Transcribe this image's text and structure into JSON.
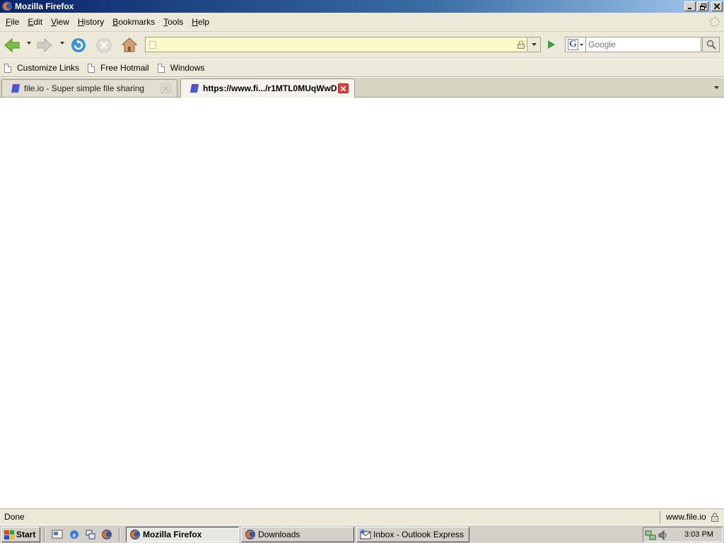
{
  "window": {
    "title": "Mozilla Firefox"
  },
  "menu": {
    "items": [
      {
        "name": "file",
        "accel": "F",
        "rest": "ile"
      },
      {
        "name": "edit",
        "accel": "E",
        "rest": "dit"
      },
      {
        "name": "view",
        "accel": "V",
        "rest": "iew"
      },
      {
        "name": "history",
        "accel": "H",
        "rest": "istory"
      },
      {
        "name": "bookmarks",
        "accel": "B",
        "rest": "ookmarks"
      },
      {
        "name": "tools",
        "accel": "T",
        "rest": "ools"
      },
      {
        "name": "help",
        "accel": "H",
        "rest": "elp"
      }
    ]
  },
  "navigation": {
    "url_value": "",
    "search_engine": "G",
    "search_placeholder": "Google"
  },
  "bookmarks": {
    "items": [
      "Customize Links",
      "Free Hotmail",
      "Windows"
    ]
  },
  "tabs": [
    {
      "label": "file.io - Super simple file sharing",
      "active": false
    },
    {
      "label": "https://www.fi.../r1MTL0MUqWwD",
      "active": true
    }
  ],
  "status": {
    "text": "Done",
    "host": "www.file.io"
  },
  "taskbar": {
    "start_label": "Start",
    "tasks": [
      {
        "label": "Mozilla Firefox",
        "active": true
      },
      {
        "label": "Downloads",
        "active": false
      },
      {
        "label": "Inbox - Outlook Express",
        "active": false
      }
    ],
    "clock": "3:03 PM"
  },
  "colors": {
    "titlebar_start": "#0a246a",
    "titlebar_end": "#a6caf0",
    "chrome": "#ece9d8",
    "url_field": "#fcf9c8",
    "tab_close_active": "#e04040"
  }
}
